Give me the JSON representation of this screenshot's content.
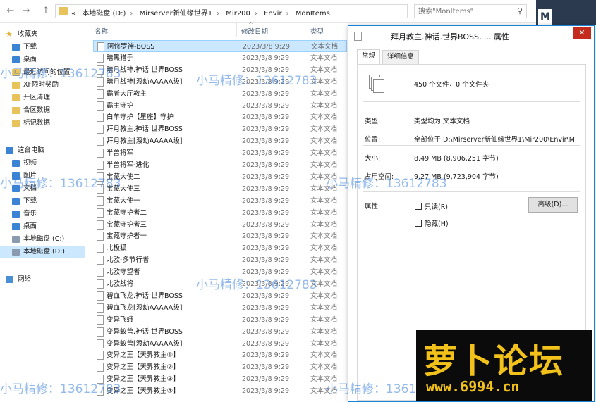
{
  "addressbar": {
    "back": "←",
    "forward": "→",
    "up": "↑",
    "overflow": "«",
    "crumbs": [
      "本地磁盘 (D:)",
      "Mirserver新仙缘世界1",
      "Mir200",
      "Envir",
      "MonItems"
    ],
    "search_placeholder": "搜索\"MonItems\""
  },
  "nav": {
    "items": [
      {
        "label": "收藏夹",
        "icon": "star-icon"
      },
      {
        "label": "下载",
        "icon": "download-folder-icon"
      },
      {
        "label": "桌面",
        "icon": "desktop-icon"
      },
      {
        "label": "最近访问的位置",
        "icon": "recent-places-icon"
      },
      {
        "label": "XF限时奖励",
        "icon": "folder-icon"
      },
      {
        "label": "开区清理",
        "icon": "folder-icon"
      },
      {
        "label": "合区数据",
        "icon": "folder-icon"
      },
      {
        "label": "标记数据",
        "icon": "folder-icon"
      },
      {
        "label": "这台电脑",
        "icon": "computer-icon"
      },
      {
        "label": "视频",
        "icon": "videos-folder-icon"
      },
      {
        "label": "图片",
        "icon": "pictures-folder-icon"
      },
      {
        "label": "文档",
        "icon": "documents-folder-icon"
      },
      {
        "label": "下载",
        "icon": "download-folder-icon"
      },
      {
        "label": "音乐",
        "icon": "music-folder-icon"
      },
      {
        "label": "桌面",
        "icon": "desktop-icon"
      },
      {
        "label": "本地磁盘 (C:)",
        "icon": "drive-icon"
      },
      {
        "label": "本地磁盘 (D:)",
        "icon": "drive-icon"
      },
      {
        "label": "网络",
        "icon": "network-icon"
      }
    ]
  },
  "list": {
    "headers": {
      "name": "名称",
      "date": "修改日期",
      "type": "类型"
    },
    "files": [
      {
        "name": "阿修罗神-BOSS",
        "date": "2023/3/8 9:29",
        "type": "文本文档"
      },
      {
        "name": "暗黑猎手",
        "date": "2023/3/8 9:29",
        "type": "文本文档"
      },
      {
        "name": "暗月战神.神话.世界BOSS",
        "date": "2023/3/8 9:29",
        "type": "文本文档"
      },
      {
        "name": "暗月战神[渡劫AAAAA级]",
        "date": "2023/3/8 9:29",
        "type": "文本文档"
      },
      {
        "name": "霸者大厅教主",
        "date": "2023/3/8 9:29",
        "type": "文本文档"
      },
      {
        "name": "霸主守护",
        "date": "2023/3/8 9:29",
        "type": "文本文档"
      },
      {
        "name": "白羊守护【星座】守护",
        "date": "2023/3/8 9:29",
        "type": "文本文档"
      },
      {
        "name": "拜月教主.神话.世界BOSS",
        "date": "2023/3/8 9:29",
        "type": "文本文档"
      },
      {
        "name": "拜月教主[渡劫AAAAA级]",
        "date": "2023/3/8 9:29",
        "type": "文本文档"
      },
      {
        "name": "半兽将军",
        "date": "2023/3/8 9:29",
        "type": "文本文档"
      },
      {
        "name": "半兽将军-进化",
        "date": "2023/3/8 9:29",
        "type": "文本文档"
      },
      {
        "name": "宝藏大使二",
        "date": "2023/3/8 9:29",
        "type": "文本文档"
      },
      {
        "name": "宝藏大使三",
        "date": "2023/3/8 9:29",
        "type": "文本文档"
      },
      {
        "name": "宝藏大使一",
        "date": "2023/3/8 9:29",
        "type": "文本文档"
      },
      {
        "name": "宝藏守护者二",
        "date": "2023/3/8 9:29",
        "type": "文本文档"
      },
      {
        "name": "宝藏守护者三",
        "date": "2023/3/8 9:29",
        "type": "文本文档"
      },
      {
        "name": "宝藏守护者一",
        "date": "2023/3/8 9:29",
        "type": "文本文档"
      },
      {
        "name": "北极狐",
        "date": "2023/3/8 9:29",
        "type": "文本文档"
      },
      {
        "name": "北欧-多节行者",
        "date": "2023/3/8 9:29",
        "type": "文本文档"
      },
      {
        "name": "北欧守望者",
        "date": "2023/3/8 9:29",
        "type": "文本文档"
      },
      {
        "name": "北欧战将",
        "date": "2023/3/8 9:29",
        "type": "文本文档"
      },
      {
        "name": "碧血飞龙.神话.世界BOSS",
        "date": "2023/3/8 9:29",
        "type": "文本文档"
      },
      {
        "name": "碧血飞龙[渡劫AAAAA级]",
        "date": "2023/3/8 9:29",
        "type": "文本文档"
      },
      {
        "name": "变异飞蛾",
        "date": "2023/3/8 9:29",
        "type": "文本文档"
      },
      {
        "name": "变异蚁兽.神话.世界BOSS",
        "date": "2023/3/8 9:29",
        "type": "文本文档"
      },
      {
        "name": "变异蚁兽[渡劫AAAAA级]",
        "date": "2023/3/8 9:29",
        "type": "文本文档"
      },
      {
        "name": "变异之王【天界教主①】",
        "date": "2023/3/8 9:29",
        "type": "文本文档"
      },
      {
        "name": "变异之王【天界教主②】",
        "date": "2023/3/8 9:29",
        "type": "文本文档"
      },
      {
        "name": "变异之王【天界教主③】",
        "date": "2023/3/8 9:29",
        "type": "文本文档"
      },
      {
        "name": "变异之王【天界教主④】",
        "date": "2023/3/8 9:29",
        "type": "文本文档"
      }
    ]
  },
  "dialog": {
    "title": "拜月教主.神话.世界BOSS, ... 属性",
    "close": "✕",
    "tabs": [
      "常规",
      "详细信息"
    ],
    "count": "450 个文件，0 个文件夹",
    "type_label": "类型:",
    "type_value": "类型均为 文本文档",
    "location_label": "位置:",
    "location_value": "全部位于 D:\\Mirserver新仙缘世界1\\Mir200\\Envir\\M",
    "size_label": "大小:",
    "size_value": "8.49 MB (8,906,251 字节)",
    "disk_size_label": "占用空间:",
    "disk_size_value": "9.27 MB (9,723,904 字节)",
    "attr_label": "属性:",
    "readonly_label": "只读(R)",
    "hidden_label": "隐藏(H)",
    "advanced_label": "高级(D)..."
  },
  "overlay": {
    "watermark": "小马精修：13612783",
    "strip_letter": "M",
    "logo_text": "萝卜论坛",
    "logo_url": "www.6994.cn"
  }
}
